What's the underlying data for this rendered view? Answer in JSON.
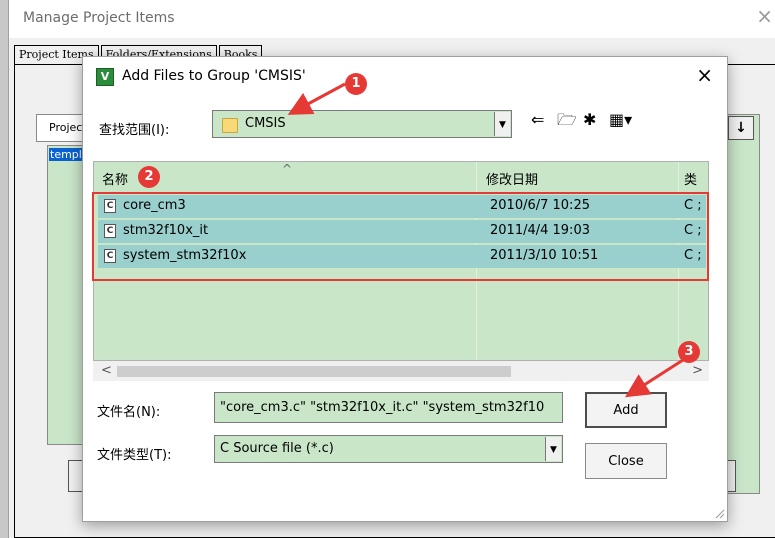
{
  "background_window": {
    "title": "Manage Project Items",
    "close_glyph": "×",
    "tabs": [
      "Project Items",
      "Folders/Extensions",
      "Books"
    ],
    "list_header": "Projec",
    "list_item": "templ",
    "arrow_glyph": "↓"
  },
  "dialog": {
    "title": "Add Files to Group 'CMSIS'",
    "close_glyph": "×",
    "look_in_label": "查找范围(I):",
    "look_in_value": "CMSIS",
    "toolbar_icons": [
      "back-icon",
      "up-folder-icon",
      "new-folder-icon",
      "view-menu-icon"
    ],
    "toolbar_glyphs": [
      "⇐",
      "🗁",
      "✱",
      "▦▾"
    ],
    "columns": {
      "name": "名称",
      "modified": "修改日期",
      "type": "类"
    },
    "sort_glyph": "^",
    "files": [
      {
        "name": "core_cm3",
        "modified": "2010/6/7 10:25",
        "type": "C ;"
      },
      {
        "name": "stm32f10x_it",
        "modified": "2011/4/4 19:03",
        "type": "C ;"
      },
      {
        "name": "system_stm32f10x",
        "modified": "2011/3/10 10:51",
        "type": "C ;"
      }
    ],
    "file_icon_glyph": "C",
    "scroll_left": "<",
    "scroll_right": ">",
    "filename_label": "文件名(N):",
    "filename_value": "\"core_cm3.c\" \"stm32f10x_it.c\" \"system_stm32f10",
    "filetype_label": "文件类型(T):",
    "filetype_value": "C Source file (*.c)",
    "dropdown_glyph": "▼",
    "add_label": "Add",
    "close_label": "Close"
  },
  "annotations": {
    "badges": [
      "1",
      "2",
      "3"
    ],
    "color": "#e53935"
  },
  "colors": {
    "list_bg": "#c9e6c9",
    "selection_bg": "#99cfcc"
  }
}
